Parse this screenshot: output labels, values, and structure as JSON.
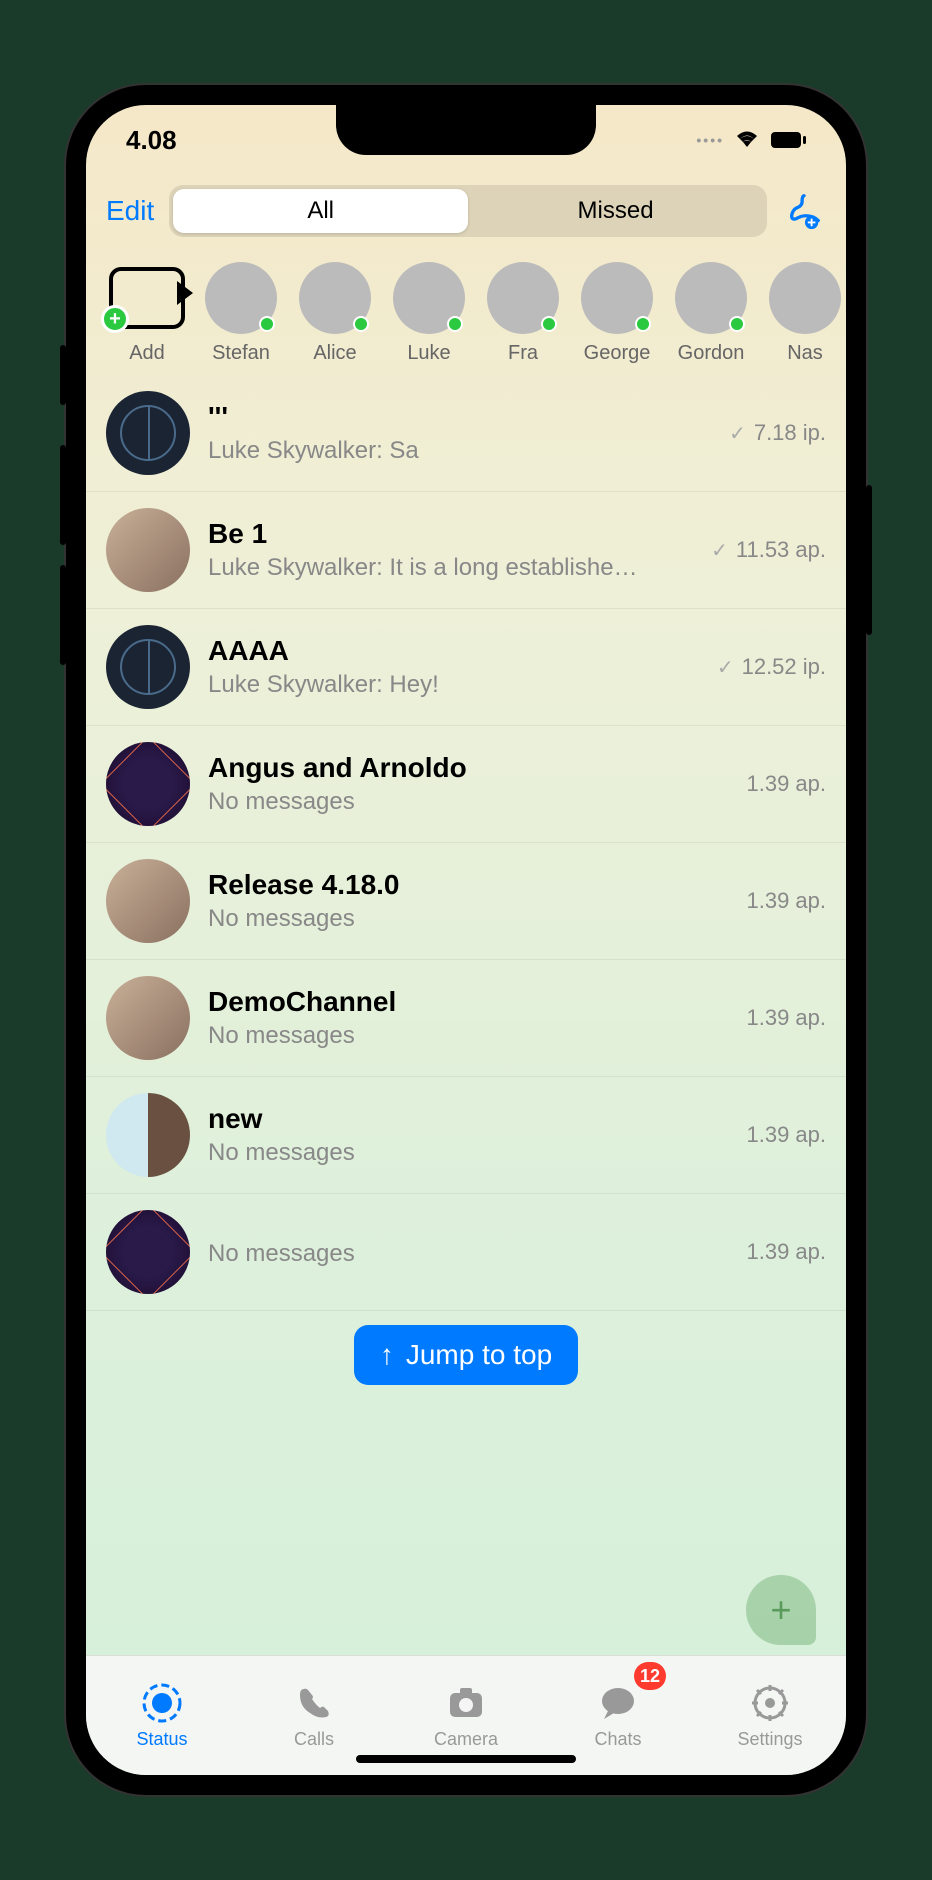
{
  "status": {
    "time": "4.08"
  },
  "header": {
    "edit": "Edit",
    "segments": {
      "all": "All",
      "missed": "Missed"
    }
  },
  "stories": {
    "add_label": "Add",
    "items": [
      {
        "name": "Stefan"
      },
      {
        "name": "Alice"
      },
      {
        "name": "Luke"
      },
      {
        "name": "Fra"
      },
      {
        "name": "George"
      },
      {
        "name": "Gordon"
      },
      {
        "name": "Nas"
      }
    ]
  },
  "chats": [
    {
      "title": "'''",
      "preview": "Luke Skywalker: Sa",
      "time": "7.18 ip.",
      "check": true,
      "avatar": "sphere"
    },
    {
      "title": "Be 1",
      "preview": "Luke Skywalker: It is a long establishe…",
      "time": "11.53 ap.",
      "check": true,
      "avatar": "face"
    },
    {
      "title": "AAAA",
      "preview": "Luke Skywalker: Hey!",
      "time": "12.52 ip.",
      "check": true,
      "avatar": "sphere"
    },
    {
      "title": "Angus and Arnoldo",
      "preview": "No messages",
      "time": "1.39 ap.",
      "check": false,
      "avatar": "geo"
    },
    {
      "title": "Release 4.18.0",
      "preview": "No messages",
      "time": "1.39 ap.",
      "check": false,
      "avatar": "face"
    },
    {
      "title": "DemoChannel",
      "preview": "No messages",
      "time": "1.39 ap.",
      "check": false,
      "avatar": "face"
    },
    {
      "title": "new",
      "preview": "No messages",
      "time": "1.39 ap.",
      "check": false,
      "avatar": "split"
    },
    {
      "title": "",
      "preview": "No messages",
      "time": "1.39 ap.",
      "check": false,
      "avatar": "geo"
    }
  ],
  "jump_button": "Jump to top",
  "tabs": {
    "status": "Status",
    "calls": "Calls",
    "camera": "Camera",
    "chats": "Chats",
    "settings": "Settings",
    "chats_badge": "12"
  }
}
